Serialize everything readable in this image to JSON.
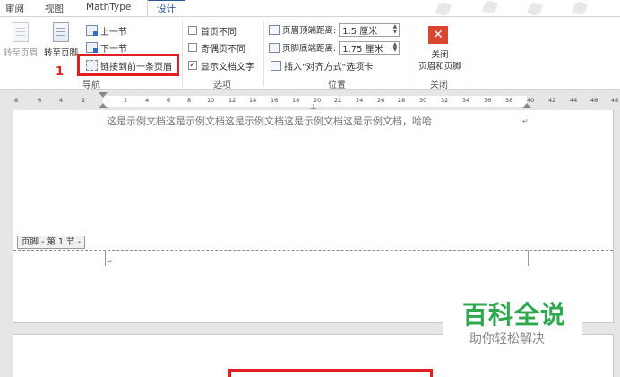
{
  "tabs": [
    {
      "label": "审阅",
      "active": false
    },
    {
      "label": "视图",
      "active": false
    },
    {
      "label": "MathType",
      "active": false
    },
    {
      "label": "设计",
      "active": true
    }
  ],
  "ribbon": {
    "navigation": {
      "goto_header": "转至页眉",
      "goto_footer": "转至页脚",
      "previous_section": "上一节",
      "next_section": "下一节",
      "link_to_previous": "链接到前一条页眉",
      "group_label": "导航"
    },
    "options": {
      "different_first_page": "首页不同",
      "different_odd_even": "奇偶页不同",
      "show_document_text": "显示文档文字",
      "show_document_text_checked": true,
      "group_label": "选项"
    },
    "position": {
      "header_from_top_label": "页眉顶端距离:",
      "header_from_top_value": "1.5 厘米",
      "footer_from_bottom_label": "页脚底端距离:",
      "footer_from_bottom_value": "1.75 厘米",
      "insert_alignment_tab": "插入\"对齐方式\"选项卡",
      "group_label": "位置"
    },
    "close": {
      "button_label_line1": "关闭",
      "button_label_line2": "页眉和页脚",
      "group_label": "关闭"
    }
  },
  "annotation": {
    "step_number": "1"
  },
  "ruler": {
    "numbers": [
      "8",
      "6",
      "4",
      "2",
      "2",
      "4",
      "6",
      "8",
      "10",
      "12",
      "14",
      "16",
      "18",
      "20",
      "22",
      "24",
      "26",
      "28",
      "30",
      "32",
      "34",
      "36",
      "38",
      "40",
      "42",
      "44",
      "46",
      "48"
    ]
  },
  "document": {
    "header_text": "这是示例文档这是示例文档这是示例文档这是示例文档这是示例文档，哈哈",
    "footer_tag": "页脚 - 第 1 节 -"
  },
  "watermark": {
    "title": "百科全说",
    "subtitle": "助你轻松解决"
  }
}
